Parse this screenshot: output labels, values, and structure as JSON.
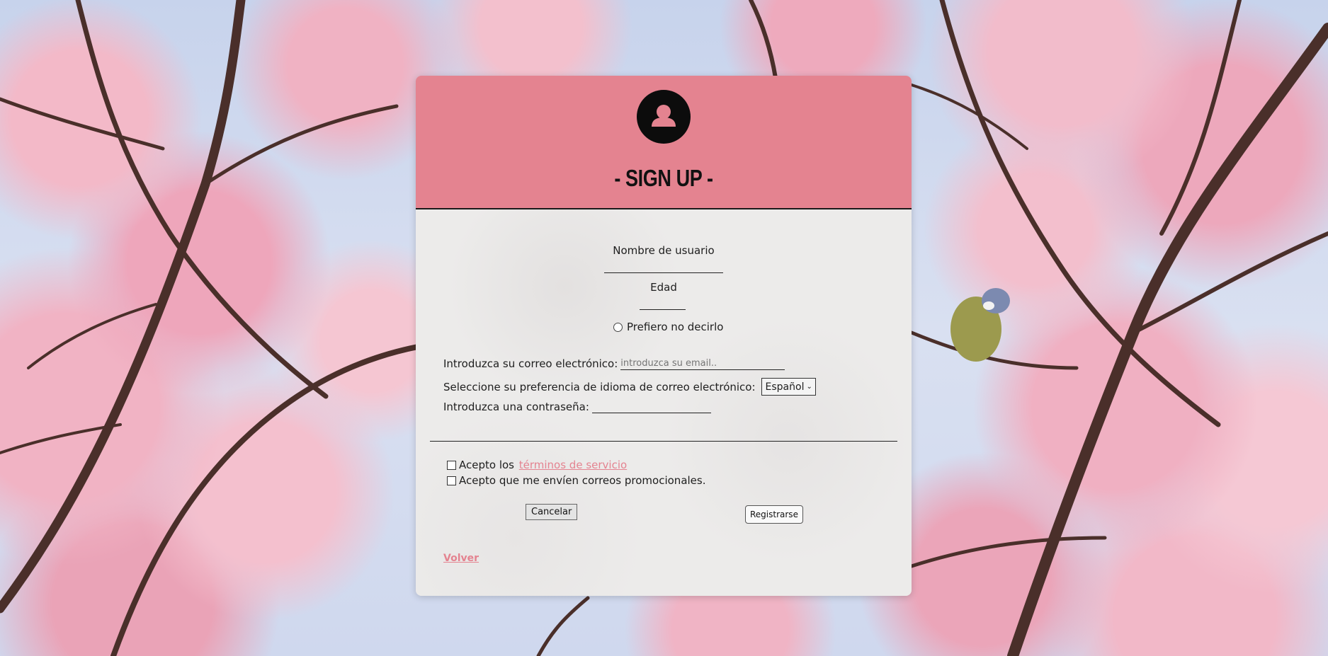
{
  "header": {
    "title": "- SIGN UP -",
    "avatar_icon": "user-icon",
    "accent_color": "#e48390"
  },
  "form": {
    "username_label": "Nombre de usuario",
    "username_value": "",
    "age_label": "Edad",
    "age_value": "",
    "prefer_not_label": "Prefiero no decirlo",
    "email_label": "Introduzca su correo electrónico:",
    "email_placeholder": "introduzca su email..",
    "language_label": "Seleccione su preferencia de idioma de correo electrónico:",
    "language_selected": "Español",
    "password_label": "Introduzca una contraseña:",
    "terms_prefix": "Acepto los ",
    "terms_link": "términos de servicio",
    "promo_label": "Acepto que me envíen correos promocionales.",
    "cancel_label": "Cancelar",
    "register_label": "Registrarse",
    "back_label": "Volver"
  }
}
